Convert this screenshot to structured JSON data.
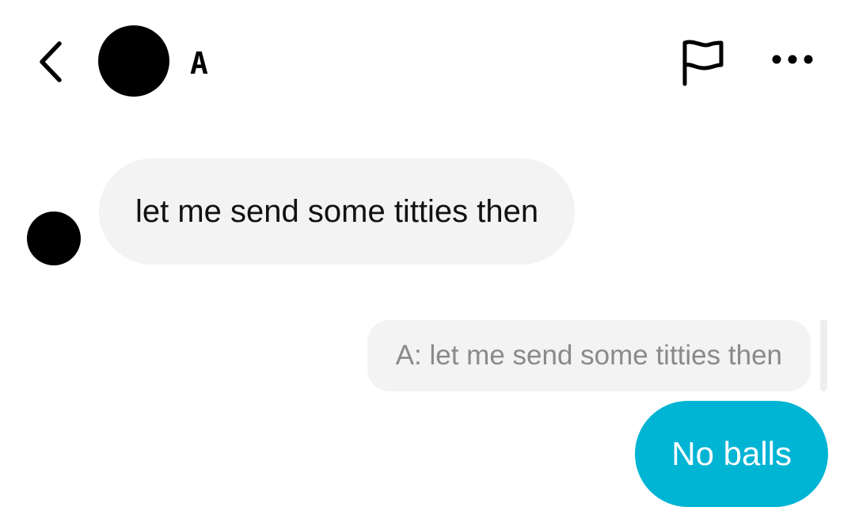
{
  "header": {
    "back_icon": "chevron-left-icon",
    "contact_name": "A",
    "report_icon": "flag-icon",
    "more_icon": "more-horizontal-icon"
  },
  "messages": [
    {
      "direction": "incoming",
      "text": "let me send some titties then"
    },
    {
      "direction": "outgoing",
      "reply_to": "A: let me send some titties then",
      "text": "No balls"
    }
  ],
  "colors": {
    "incoming_bubble": "#f3f3f3",
    "outgoing_bubble": "#00b4d4",
    "quote_text": "#8a8a8a"
  }
}
